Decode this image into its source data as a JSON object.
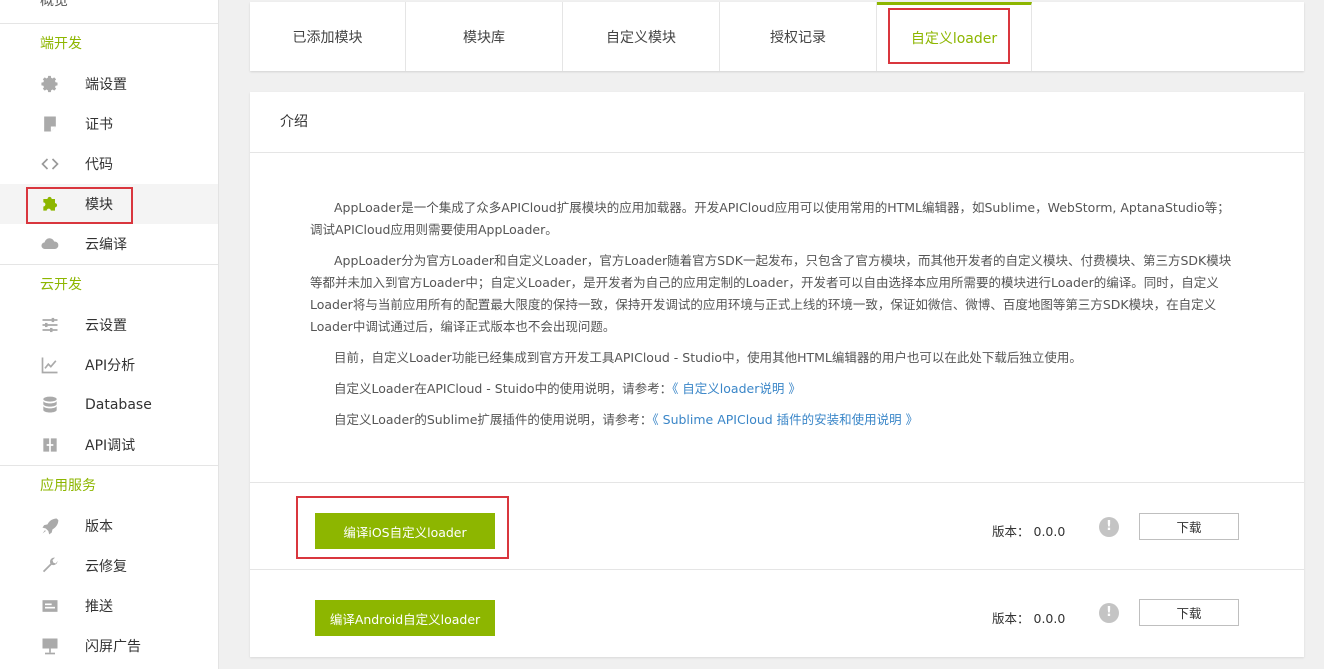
{
  "sidebar": {
    "top_label": "概览",
    "sections": [
      {
        "title": "端开发",
        "items": [
          {
            "label": "端设置",
            "icon": "gear-icon"
          },
          {
            "label": "证书",
            "icon": "certificate-icon"
          },
          {
            "label": "代码",
            "icon": "code-icon"
          },
          {
            "label": "模块",
            "icon": "puzzle-icon",
            "active": true
          },
          {
            "label": "云编译",
            "icon": "cloud-icon"
          }
        ]
      },
      {
        "title": "云开发",
        "items": [
          {
            "label": "云设置",
            "icon": "sliders-icon"
          },
          {
            "label": "API分析",
            "icon": "chart-icon"
          },
          {
            "label": "Database",
            "icon": "database-icon"
          },
          {
            "label": "API调试",
            "icon": "debug-icon"
          }
        ]
      },
      {
        "title": "应用服务",
        "items": [
          {
            "label": "版本",
            "icon": "rocket-icon"
          },
          {
            "label": "云修复",
            "icon": "wrench-icon"
          },
          {
            "label": "推送",
            "icon": "push-icon"
          },
          {
            "label": "闪屏广告",
            "icon": "ad-icon"
          }
        ]
      }
    ]
  },
  "tabs": [
    {
      "label": "已添加模块"
    },
    {
      "label": "模块库"
    },
    {
      "label": "自定义模块"
    },
    {
      "label": "授权记录"
    },
    {
      "label": "自定义loader",
      "active": true
    }
  ],
  "card": {
    "title": "介绍",
    "paragraphs": [
      {
        "text": "AppLoader是一个集成了众多APICloud扩展模块的应用加载器。开发APICloud应用可以使用常用的HTML编辑器，如Sublime，WebStorm, AptanaStudio等；调试APICloud应用则需要使用AppLoader。"
      },
      {
        "text": "AppLoader分为官方Loader和自定义Loader，官方Loader随着官方SDK一起发布，只包含了官方模块，而其他开发者的自定义模块、付费模块、第三方SDK模块等都并未加入到官方Loader中；自定义Loader，是开发者为自己的应用定制的Loader，开发者可以自由选择本应用所需要的模块进行Loader的编译。同时，自定义Loader将与当前应用所有的配置最大限度的保持一致，保持开发调试的应用环境与正式上线的环境一致，保证如微信、微博、百度地图等第三方SDK模块，在自定义Loader中调试通过后，编译正式版本也不会出现问题。"
      },
      {
        "text": "目前，自定义Loader功能已经集成到官方开发工具APICloud - Studio中，使用其他HTML编辑器的用户也可以在此处下载后独立使用。"
      },
      {
        "text": "自定义Loader在APICloud - Stuido中的使用说明，请参考：",
        "link": "《 自定义loader说明 》"
      },
      {
        "text": "自定义Loader的Sublime扩展插件的使用说明，请参考：",
        "link": "《 Sublime APICloud 插件的安装和使用说明 》"
      }
    ],
    "builds": [
      {
        "button": "编译iOS自定义loader",
        "version_label": "版本：",
        "version": "0.0.0",
        "download": "下载"
      },
      {
        "button": "编译Android自定义loader",
        "version_label": "版本：",
        "version": "0.0.0",
        "download": "下载"
      }
    ]
  },
  "colors": {
    "accent": "#8db600",
    "highlight": "#d9363e",
    "link": "#3a86c8"
  }
}
